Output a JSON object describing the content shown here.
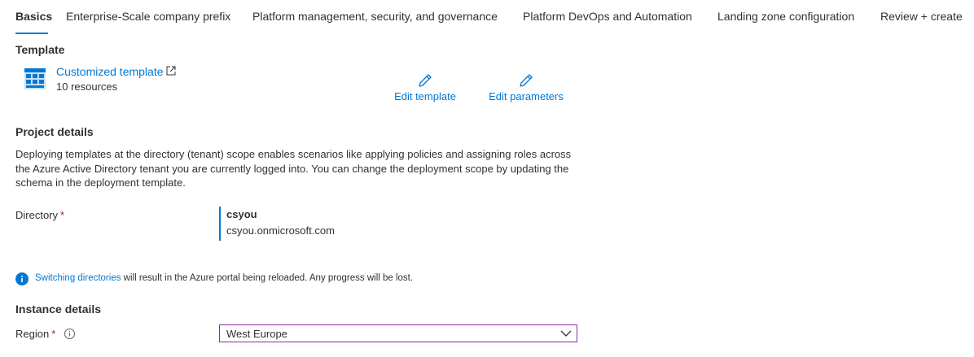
{
  "tabs": [
    {
      "label": "Basics",
      "active": true
    },
    {
      "label": "Enterprise-Scale company prefix",
      "active": false
    },
    {
      "label": "Platform management, security, and governance",
      "active": false
    },
    {
      "label": "Platform DevOps and Automation",
      "active": false
    },
    {
      "label": "Landing zone configuration",
      "active": false
    },
    {
      "label": "Review + create",
      "active": false
    }
  ],
  "template": {
    "section_title": "Template",
    "link": "Customized template",
    "resources": "10 resources",
    "edit_template": "Edit template",
    "edit_parameters": "Edit parameters"
  },
  "project": {
    "section_title": "Project details",
    "description": "Deploying templates at the directory (tenant) scope enables scenarios like applying policies and assigning roles across the Azure Active Directory tenant you are currently logged into. You can change the deployment scope by updating the schema in the deployment template.",
    "directory_label": "Directory",
    "required_mark": "*",
    "directory_name": "csyou",
    "directory_domain": "csyou.onmicrosoft.com"
  },
  "info": {
    "link": "Switching directories",
    "text": " will result in the Azure portal being reloaded. Any progress will be lost."
  },
  "instance": {
    "section_title": "Instance details",
    "region_label": "Region",
    "required_mark": "*",
    "region_value": "West Europe"
  },
  "colors": {
    "accent": "#0078d4",
    "required": "#a4262c",
    "select_border": "#8a2da5"
  },
  "icons": [
    "template-icon",
    "external-link-icon",
    "pencil-icon",
    "info-icon",
    "help-icon",
    "chevron-down-icon"
  ]
}
